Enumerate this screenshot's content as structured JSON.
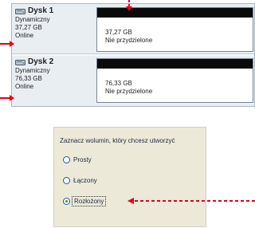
{
  "disks": [
    {
      "title": "Dysk 1",
      "type": "Dynamiczny",
      "size": "37,27 GB",
      "status": "Online",
      "volume": {
        "size": "37,27 GB",
        "state": "Nie przydzielone"
      }
    },
    {
      "title": "Dysk 2",
      "type": "Dynamiczny",
      "size": "76,33 GB",
      "status": "Online",
      "volume": {
        "size": "76,33 GB",
        "state": "Nie przydzielone"
      }
    }
  ],
  "wizard": {
    "prompt": "Zaznacz wolumin, który chcesz utworzyć",
    "options": [
      {
        "label": "Prosty",
        "selected": false
      },
      {
        "label": "Łączony",
        "selected": false
      },
      {
        "label": "Rozłożony",
        "selected": true
      }
    ]
  },
  "colors": {
    "arrow": "#e3001b",
    "accent": "#1f5a9e",
    "panel": "#e9eef3",
    "dialog": "#ece9d8"
  },
  "icons": {
    "disk": "hard-disk-icon",
    "arrow": "red-arrow"
  }
}
